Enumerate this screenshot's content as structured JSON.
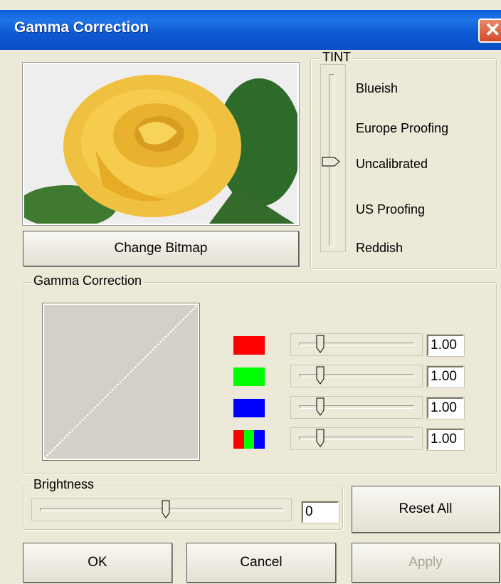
{
  "window": {
    "title": "Gamma Correction"
  },
  "preview": {
    "button_label": "Change Bitmap"
  },
  "tint": {
    "legend": "TINT",
    "options": [
      "Blueish",
      "Europe Proofing",
      "Uncalibrated",
      "US Proofing",
      "Reddish"
    ],
    "selected": "Uncalibrated"
  },
  "gamma": {
    "legend": "Gamma Correction",
    "channels": [
      {
        "channel": "red",
        "color": "#ff0000",
        "value": "1.00"
      },
      {
        "channel": "green",
        "color": "#00ff00",
        "value": "1.00"
      },
      {
        "channel": "blue",
        "color": "#0000ff",
        "value": "1.00"
      },
      {
        "channel": "rgb",
        "color": "#ff0000",
        "value": "1.00"
      }
    ]
  },
  "brightness": {
    "legend": "Brightness",
    "value": "0",
    "level": 0.5
  },
  "buttons": {
    "reset_all": "Reset All",
    "ok": "OK",
    "cancel": "Cancel",
    "apply": "Apply"
  }
}
